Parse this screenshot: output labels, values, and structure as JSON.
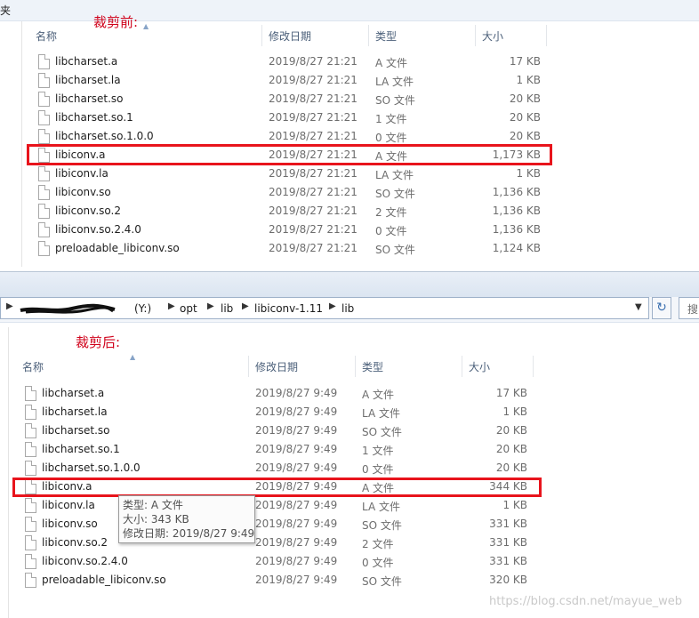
{
  "before": {
    "annotation": "裁剪前:",
    "strip_text": "夹",
    "columns": {
      "name": "名称",
      "date": "修改日期",
      "type": "类型",
      "size": "大小"
    },
    "rows": [
      {
        "name": "libcharset.a",
        "date": "2019/8/27 21:21",
        "type": "A 文件",
        "size": "17 KB"
      },
      {
        "name": "libcharset.la",
        "date": "2019/8/27 21:21",
        "type": "LA 文件",
        "size": "1 KB"
      },
      {
        "name": "libcharset.so",
        "date": "2019/8/27 21:21",
        "type": "SO 文件",
        "size": "20 KB"
      },
      {
        "name": "libcharset.so.1",
        "date": "2019/8/27 21:21",
        "type": "1 文件",
        "size": "20 KB"
      },
      {
        "name": "libcharset.so.1.0.0",
        "date": "2019/8/27 21:21",
        "type": "0 文件",
        "size": "20 KB"
      },
      {
        "name": "libiconv.a",
        "date": "2019/8/27 21:21",
        "type": "A 文件",
        "size": "1,173 KB"
      },
      {
        "name": "libiconv.la",
        "date": "2019/8/27 21:21",
        "type": "LA 文件",
        "size": "1 KB"
      },
      {
        "name": "libiconv.so",
        "date": "2019/8/27 21:21",
        "type": "SO 文件",
        "size": "1,136 KB"
      },
      {
        "name": "libiconv.so.2",
        "date": "2019/8/27 21:21",
        "type": "2 文件",
        "size": "1,136 KB"
      },
      {
        "name": "libiconv.so.2.4.0",
        "date": "2019/8/27 21:21",
        "type": "0 文件",
        "size": "1,136 KB"
      },
      {
        "name": "preloadable_libiconv.so",
        "date": "2019/8/27 21:21",
        "type": "SO 文件",
        "size": "1,124 KB"
      }
    ]
  },
  "address": {
    "drive": "(Y:)",
    "segments": [
      "opt",
      "lib",
      "libiconv-1.11",
      "lib"
    ],
    "search_placeholder": "搜"
  },
  "after": {
    "annotation": "裁剪后:",
    "columns": {
      "name": "名称",
      "date": "修改日期",
      "type": "类型",
      "size": "大小"
    },
    "rows": [
      {
        "name": "libcharset.a",
        "date": "2019/8/27 9:49",
        "type": "A 文件",
        "size": "17 KB"
      },
      {
        "name": "libcharset.la",
        "date": "2019/8/27 9:49",
        "type": "LA 文件",
        "size": "1 KB"
      },
      {
        "name": "libcharset.so",
        "date": "2019/8/27 9:49",
        "type": "SO 文件",
        "size": "20 KB"
      },
      {
        "name": "libcharset.so.1",
        "date": "2019/8/27 9:49",
        "type": "1 文件",
        "size": "20 KB"
      },
      {
        "name": "libcharset.so.1.0.0",
        "date": "2019/8/27 9:49",
        "type": "0 文件",
        "size": "20 KB"
      },
      {
        "name": "libiconv.a",
        "date": "2019/8/27 9:49",
        "type": "A 文件",
        "size": "344 KB"
      },
      {
        "name": "libiconv.la",
        "date": "2019/8/27 9:49",
        "type": "LA 文件",
        "size": "1 KB"
      },
      {
        "name": "libiconv.so",
        "date": "2019/8/27 9:49",
        "type": "SO 文件",
        "size": "331 KB"
      },
      {
        "name": "libiconv.so.2",
        "date": "2019/8/27 9:49",
        "type": "2 文件",
        "size": "331 KB"
      },
      {
        "name": "libiconv.so.2.4.0",
        "date": "2019/8/27 9:49",
        "type": "0 文件",
        "size": "331 KB"
      },
      {
        "name": "preloadable_libiconv.so",
        "date": "2019/8/27 9:49",
        "type": "SO 文件",
        "size": "320 KB"
      }
    ]
  },
  "tooltip": {
    "type_line": "类型: A 文件",
    "size_line": "大小: 343 KB",
    "date_line": "修改日期: 2019/8/27 9:49"
  },
  "watermark": "https://blog.csdn.net/mayue_web"
}
